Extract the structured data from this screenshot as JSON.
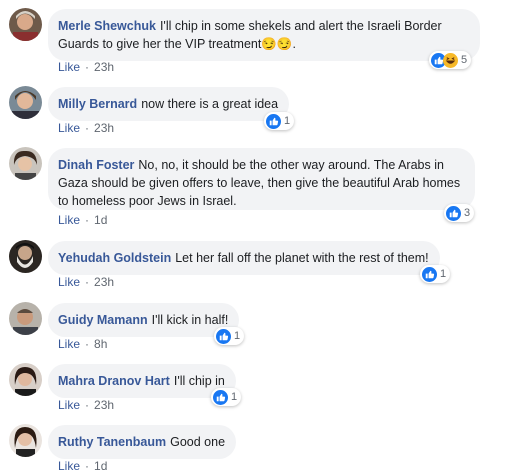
{
  "comments": [
    {
      "author": "Merle Shewchuk",
      "text": "I'll chip in some shekels and alert the Israeli Border Guards to give her the VIP treatment",
      "emoji": "😏😏.",
      "like_label": "Like",
      "time": "23h",
      "reaction_count": "5",
      "reaction_icons": [
        "like-icon",
        "haha-icon"
      ]
    },
    {
      "author": "Milly Bernard",
      "text": "now there is a great idea",
      "like_label": "Like",
      "time": "23h",
      "reaction_count": "1",
      "reaction_icons": [
        "like-icon"
      ]
    },
    {
      "author": "Dinah Foster",
      "text": "No, no, it should be the other way around. The Arabs in Gaza should be given offers to leave, then give the beautiful Arab homes to homeless poor Jews in Israel.",
      "like_label": "Like",
      "time": "1d",
      "reaction_count": "3",
      "reaction_icons": [
        "like-icon"
      ]
    },
    {
      "author": "Yehudah Goldstein",
      "text": "Let her fall off the planet with the rest of them!",
      "like_label": "Like",
      "time": "23h",
      "reaction_count": "1",
      "reaction_icons": [
        "like-icon"
      ]
    },
    {
      "author": "Guidy Mamann",
      "text": "I'll kick in half!",
      "like_label": "Like",
      "time": "8h",
      "reaction_count": "1",
      "reaction_icons": [
        "like-icon"
      ]
    },
    {
      "author": "Mahra Dranov Hart",
      "text": "I'll chip in",
      "like_label": "Like",
      "time": "23h",
      "reaction_count": "1",
      "reaction_icons": [
        "like-icon"
      ]
    },
    {
      "author": "Ruthy Tanenbaum",
      "text": "Good one",
      "like_label": "Like",
      "time": "1d"
    }
  ],
  "colors": {
    "author_link": "#385898",
    "bubble_bg": "#f2f3f5",
    "like_blue": "#1877f2",
    "haha_yellow": "#f7b928"
  }
}
